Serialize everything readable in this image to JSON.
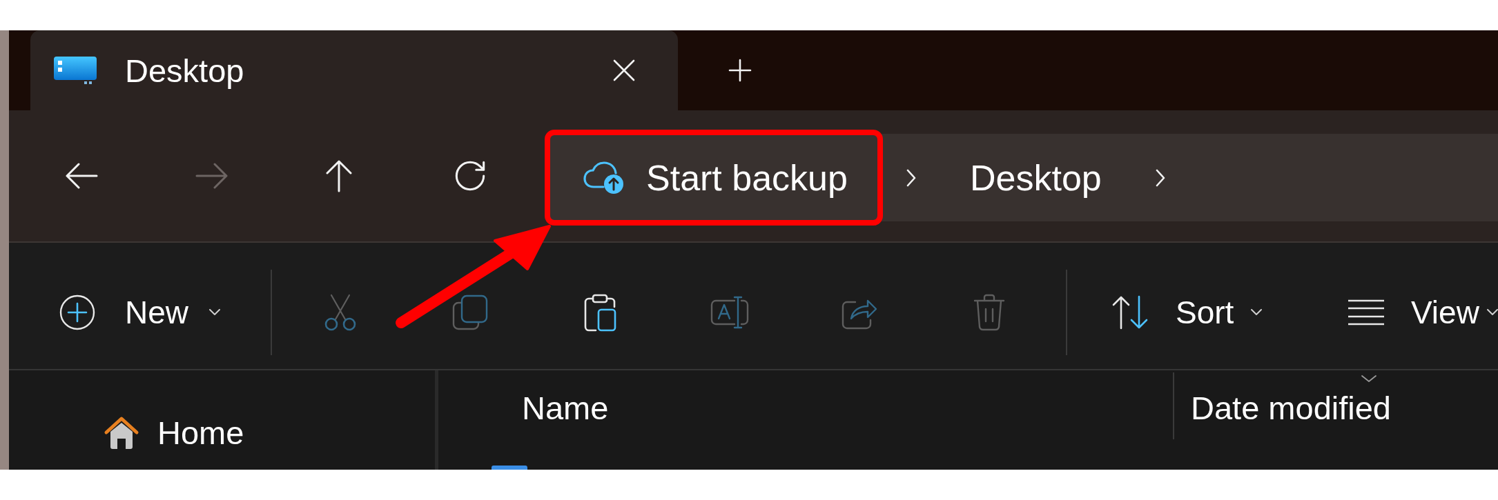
{
  "tab_bar": {
    "tabs": [
      {
        "title": "Desktop",
        "selected": true
      }
    ]
  },
  "navigation": {
    "buttons": [
      {
        "kind": "back",
        "disabled": false
      },
      {
        "kind": "forward",
        "disabled": true
      },
      {
        "kind": "up",
        "disabled": false
      },
      {
        "kind": "refresh",
        "disabled": false
      }
    ]
  },
  "address_bar": {
    "segments": [
      {
        "kind": "backup",
        "label": "Start backup",
        "highlighted": true
      },
      {
        "kind": "folder",
        "label": "Desktop",
        "highlighted": false
      }
    ]
  },
  "toolbar": {
    "items": [
      {
        "kind": "new",
        "label": "New",
        "disabled": false
      },
      {
        "kind": "separator"
      },
      {
        "kind": "cut",
        "disabled": true
      },
      {
        "kind": "copy",
        "disabled": true
      },
      {
        "kind": "paste",
        "disabled": false
      },
      {
        "kind": "rename",
        "disabled": true
      },
      {
        "kind": "share",
        "disabled": true
      },
      {
        "kind": "delete",
        "disabled": true
      },
      {
        "kind": "separator"
      },
      {
        "kind": "sort",
        "label": "Sort",
        "disabled": false
      },
      {
        "kind": "view",
        "label": "View",
        "disabled": false
      }
    ]
  },
  "sidebar": {
    "items": [
      {
        "label": "Home",
        "selected": false
      }
    ]
  },
  "file_list": {
    "columns": [
      {
        "label": "Name",
        "sorted": false
      },
      {
        "label": "Date modified",
        "sorted": true
      }
    ]
  }
}
